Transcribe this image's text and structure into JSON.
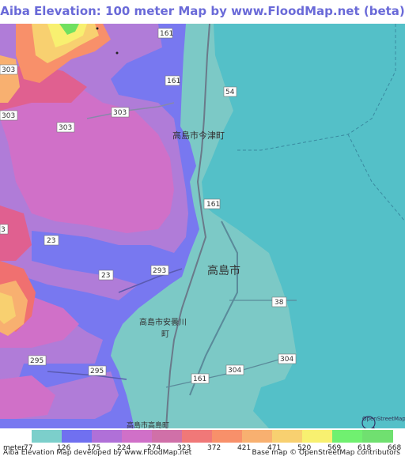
{
  "title": "Aiba Elevation: 100 meter Map by www.FloodMap.net (beta)",
  "map": {
    "road_labels": {
      "r161_top": "161",
      "r161_mid": "161",
      "r161_south": "161",
      "r161_bottom": "161",
      "r54": "54",
      "r303_a": "303",
      "r303_b": "303",
      "r303_c": "303",
      "r303_d": "303",
      "r23_a": "23",
      "r23_b": "23",
      "r3_edge": "3",
      "r293": "293",
      "r295_a": "295",
      "r295_b": "295",
      "r38": "38",
      "r304_a": "304",
      "r304_b": "304"
    },
    "place_labels": {
      "imazu": "高島市今津町",
      "takashima": "高島市",
      "adogawa_1": "高島市安曇川",
      "adogawa_2": "町",
      "takashima_cho": "高島市高島町"
    },
    "attribution_logo": "OpenStreetMap",
    "colors": {
      "water": "#54c0c8",
      "lowland": "#7cc9c6",
      "elev_126": "#7878f0",
      "elev_175": "#b07cd8",
      "elev_224": "#d070c8",
      "elev_274": "#e06090",
      "elev_323": "#f07070",
      "elev_372": "#f8906a",
      "elev_421": "#f8b070",
      "elev_471": "#f8d070",
      "elev_520": "#f8f070",
      "elev_569": "#80f070",
      "elev_618": "#70e060"
    }
  },
  "legend": {
    "unit_label": "meter",
    "ticks": [
      "77",
      "126",
      "175",
      "224",
      "274",
      "323",
      "372",
      "421",
      "471",
      "520",
      "569",
      "618",
      "668"
    ],
    "colors": [
      "#7ccfcb",
      "#7070f0",
      "#b070d8",
      "#d070c8",
      "#d070a8",
      "#f07878",
      "#f8906a",
      "#f8b070",
      "#f8d070",
      "#f8f070",
      "#70f070",
      "#70e070"
    ]
  },
  "footer": {
    "left": "Aiba Elevation Map developed by www.FloodMap.net",
    "right": "Base map © OpenStreetMap contributors"
  }
}
